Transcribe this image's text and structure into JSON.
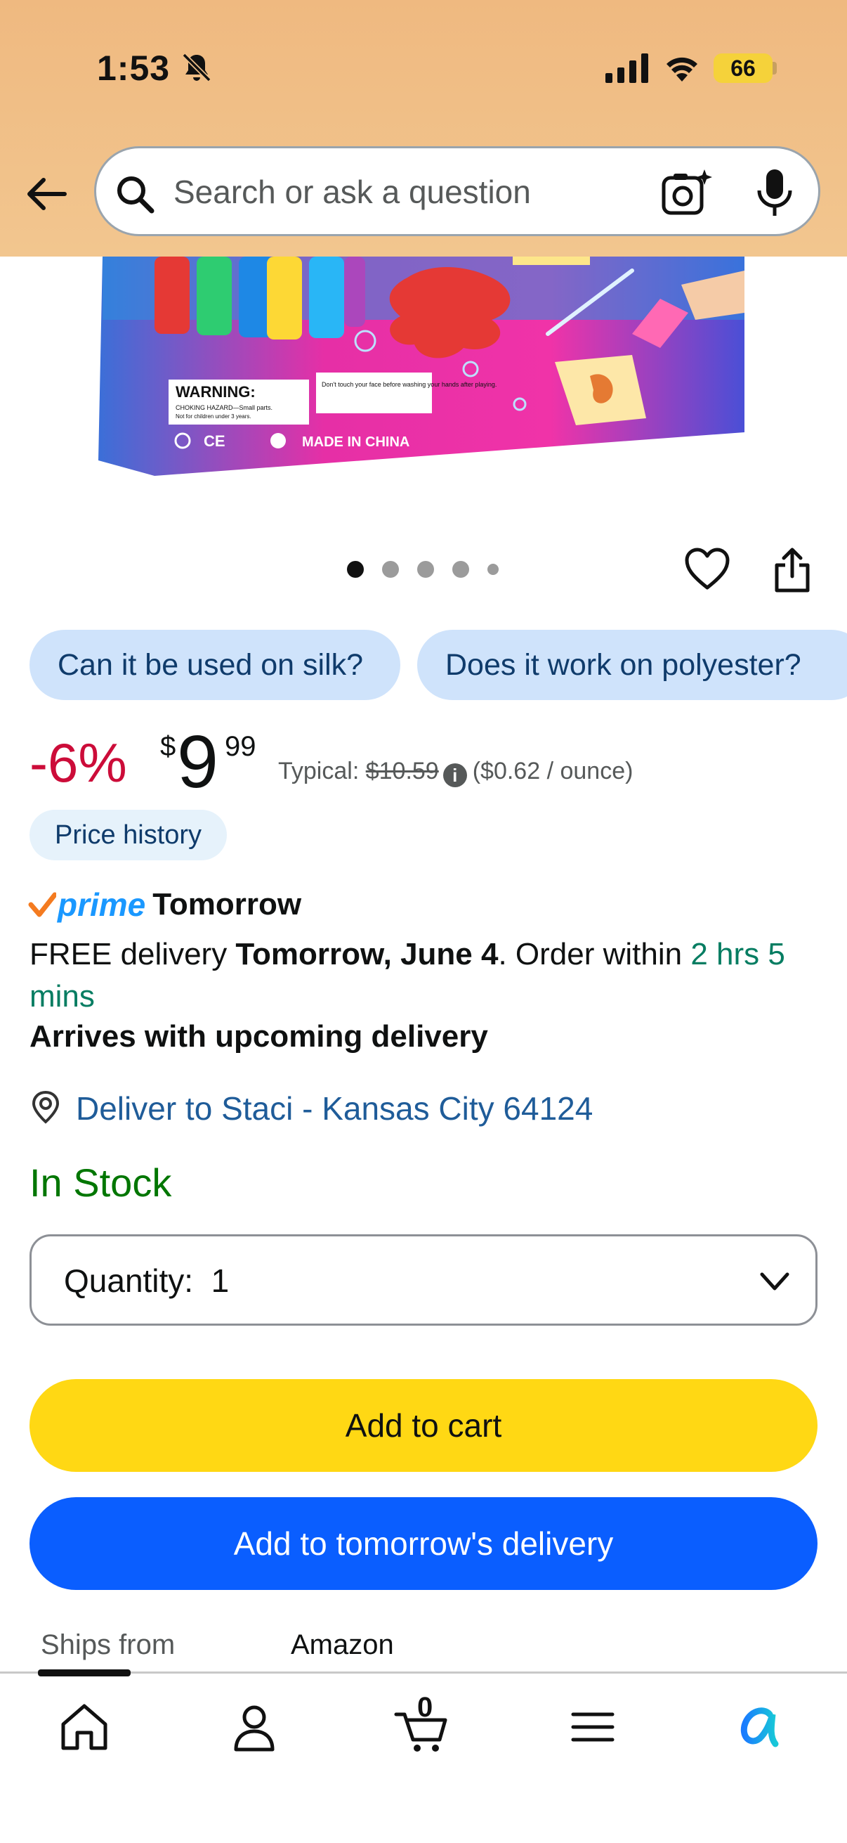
{
  "status_bar": {
    "time": "1:53",
    "battery": "66"
  },
  "search": {
    "placeholder": "Search or ask a question"
  },
  "product_image": {
    "warning": "WARNING:",
    "hazard": "CHOKING HAZARD—Small parts.",
    "not_for_children": "Not for children under 3 years.",
    "note": "Don't touch your face before washing your hands after playing.",
    "made_in": "MADE IN CHINA"
  },
  "carousel": {
    "total_images": 5,
    "active_index": 0
  },
  "questions": [
    "Can it be used on silk?",
    "Does it work on polyester?"
  ],
  "price": {
    "discount": "-6%",
    "currency_symbol": "$",
    "whole": "9",
    "fraction": "99",
    "typical_label": "Typical:",
    "typical_price": "$10.59",
    "unit_price": "($0.62 / ounce)",
    "history_label": "Price history"
  },
  "delivery": {
    "prime_label": "prime",
    "prime_day": "Tomorrow",
    "free_prefix": "FREE delivery",
    "date": "Tomorrow, June 4",
    "order_within_prefix": ". Order within",
    "countdown": "2 hrs 5 mins",
    "arrives": "Arrives with upcoming delivery",
    "deliver_to": "Deliver to Staci - Kansas City 64124"
  },
  "stock": {
    "status": "In Stock"
  },
  "quantity": {
    "label": "Quantity:",
    "value": "1"
  },
  "buttons": {
    "add_to_cart": "Add to cart",
    "add_tomorrow": "Add to tomorrow's delivery"
  },
  "ships_from": {
    "label": "Ships from",
    "value": "Amazon"
  },
  "bottom_nav": {
    "cart_count": "0"
  },
  "colors": {
    "header_bg": "#f0c08a",
    "discount": "#cc0c39",
    "in_stock": "#007600",
    "countdown": "#067d62",
    "add_to_cart_bg": "#ffd814",
    "add_tomorrow_bg": "#0a5eff",
    "link": "#1f5c99",
    "chip_bg": "#cfe3fb"
  }
}
